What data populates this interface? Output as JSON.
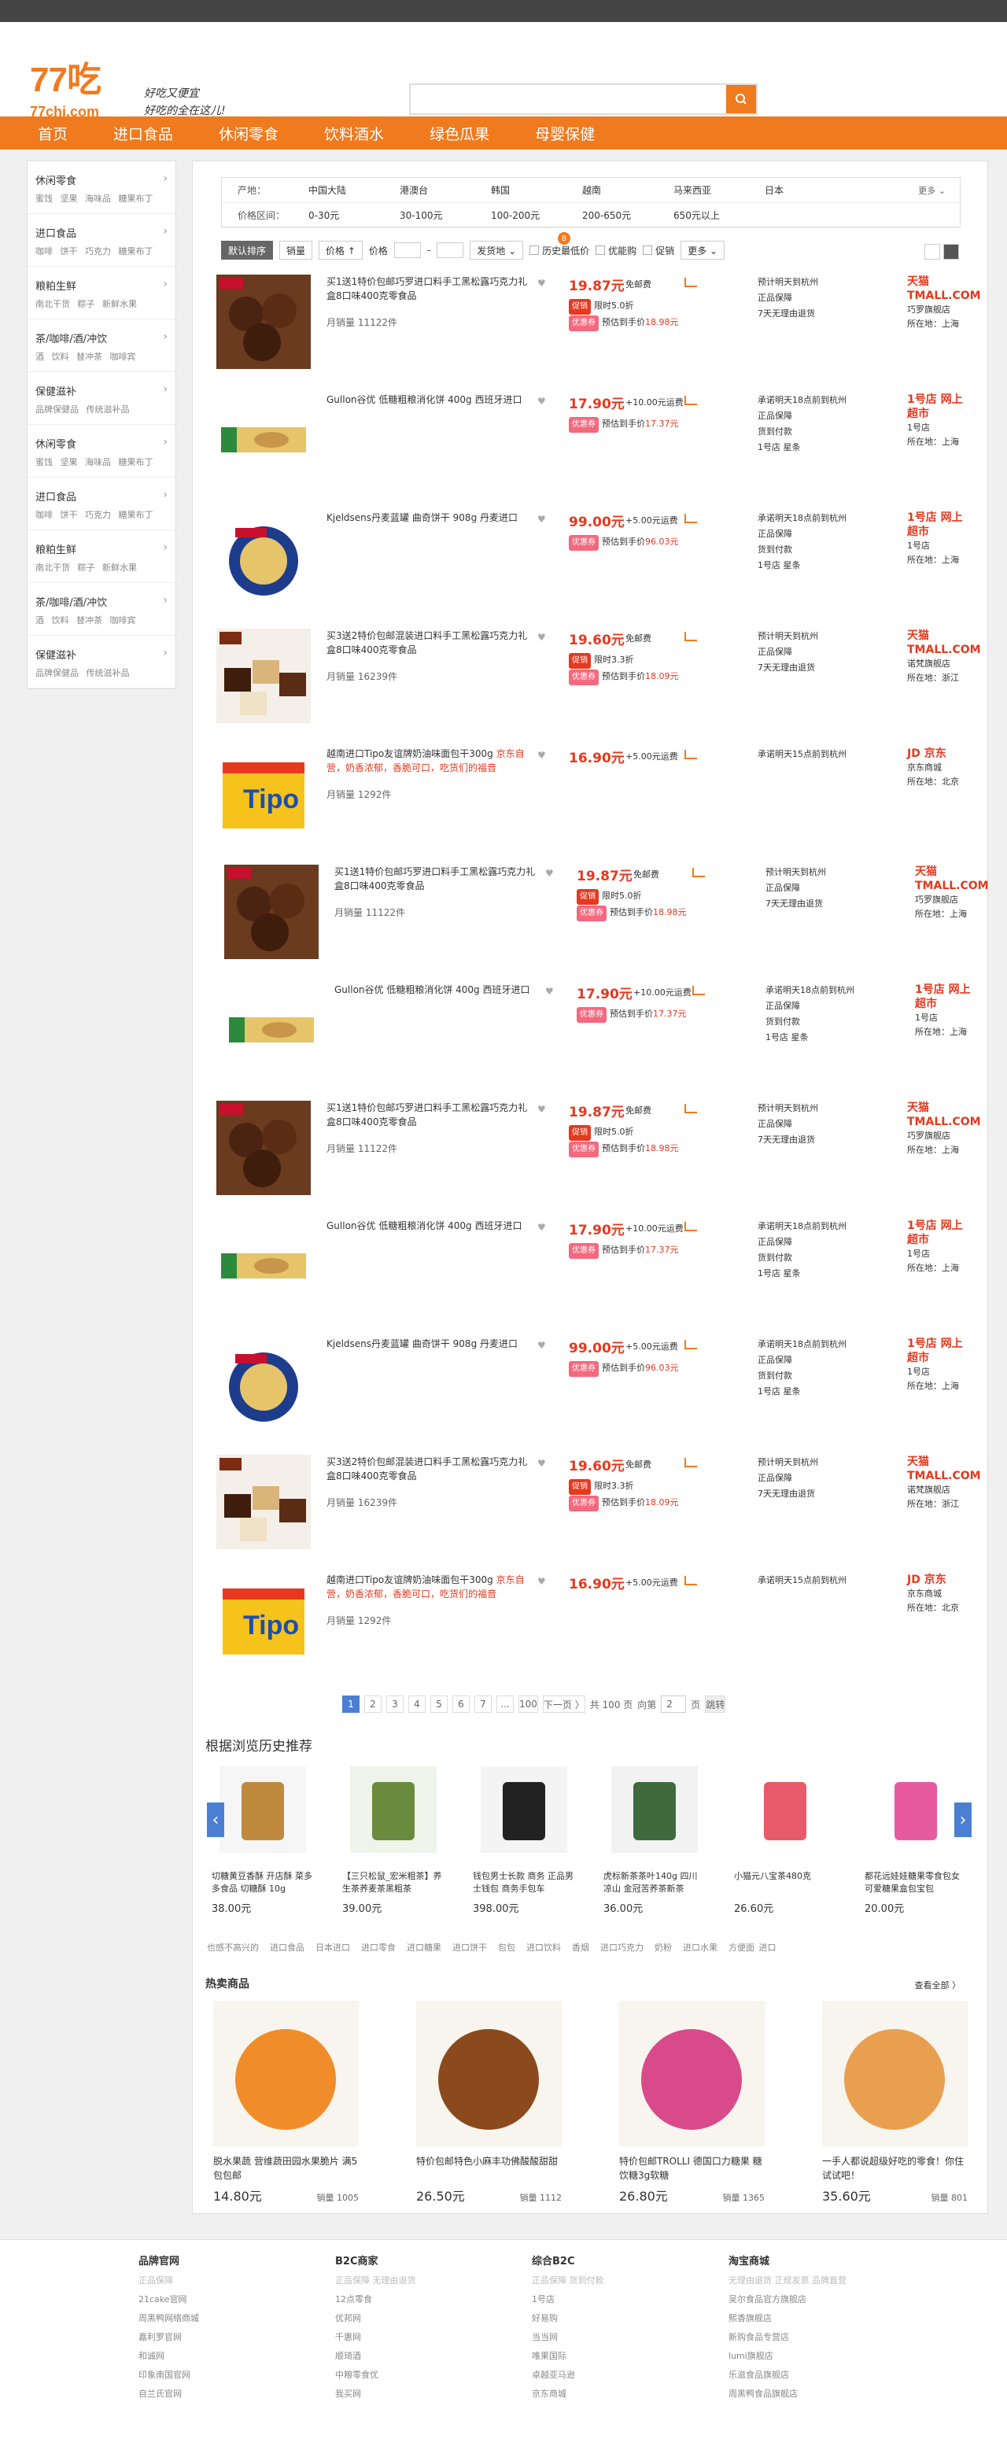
{
  "brand": {
    "logo": "77吃",
    "domain": "77chi.com",
    "slogan_1": "好吃又便宜",
    "slogan_2": "好吃的全在这儿!",
    "accent": "#f07a1e"
  },
  "nav": [
    "首页",
    "进口食品",
    "休闲零食",
    "饮料酒水",
    "绿色瓜果",
    "母婴保健"
  ],
  "sidebar": [
    {
      "title": "休闲零食",
      "sub": "蜜饯 坚果 海味品 糖果布丁"
    },
    {
      "title": "进口食品",
      "sub": "咖啡 饼干 巧克力 糖果布丁"
    },
    {
      "title": "粮粕生鲜",
      "sub": "南北干货 粽子 新鲜水果"
    },
    {
      "title": "茶/咖啡/酒/冲饮",
      "sub": "酒 饮料 替冲茶 咖啡宾"
    },
    {
      "title": "保健滋补",
      "sub": "品牌保健品 传统滋补品"
    },
    {
      "title": "休闲零食",
      "sub": "蜜饯 坚果 海味品 糖果布丁"
    },
    {
      "title": "进口食品",
      "sub": "咖啡 饼干 巧克力 糖果布丁"
    },
    {
      "title": "粮粕生鲜",
      "sub": "南北干货 粽子 新鲜水果"
    },
    {
      "title": "茶/咖啡/酒/冲饮",
      "sub": "酒 饮料 替冲茶 咖啡宾"
    },
    {
      "title": "保健滋补",
      "sub": "品牌保健品 传统滋补品"
    }
  ],
  "filter": {
    "origin_label": "产地：",
    "origins": [
      "中国大陆",
      "港澳台",
      "韩国",
      "越南",
      "马来西亚",
      "日本"
    ],
    "more": "更多 ⌄",
    "price_label": "价格区间：",
    "prices": [
      "0-30元",
      "30-100元",
      "100-200元",
      "200-650元",
      "650元以上"
    ]
  },
  "sort": {
    "default": "默认排序",
    "sales": "销量",
    "price": "价格 ↑",
    "price_range": "价格",
    "ship": "发货地 ⌄",
    "history_low": "历史最低价",
    "discount": "优能购",
    "promo": "促销",
    "more": "更多 ⌄",
    "badge": "8"
  },
  "products": [
    {
      "name": "买1送1特价包邮巧罗进口料手工黑松露巧克力礼盒8口味400克零食品",
      "promo": "",
      "sales": "月销量 11122件",
      "price": "19.87元",
      "ship": "免邮费",
      "tag1": "促销",
      "tag1_text": "限时5.0折",
      "tag2": "优惠券",
      "tag2_text": "预估到手价",
      "final": "18.98元",
      "logi": [
        "预计明天到杭州",
        "正品保障",
        "7天无理由退货"
      ],
      "shop_brand": "天猫 TMALL.COM",
      "shop_name": "巧罗旗舰店",
      "shop_loc": "所在地：上海",
      "img": "choco",
      "brand_color": "#e8381e"
    },
    {
      "name": "Gullon谷优 低糖粗粮消化饼 400g 西班牙进口",
      "promo": "",
      "sales": "",
      "price": "17.90元",
      "ship": "+10.00元运费",
      "tag1": "",
      "tag1_text": "",
      "tag2": "优惠券",
      "tag2_text": "预估到手价",
      "final": "17.37元",
      "logi": [
        "承诺明天18点前到杭州",
        "正品保障",
        "货到付款",
        "1号店 星条"
      ],
      "shop_brand": "1号店 网上超市",
      "shop_name": "1号店",
      "shop_loc": "所在地：上海",
      "img": "biscuit",
      "brand_color": "#e8381e"
    },
    {
      "name": "Kjeldsens丹麦蓝罐 曲奇饼干 908g 丹麦进口",
      "promo": "",
      "sales": "",
      "price": "99.00元",
      "ship": "+5.00元运费",
      "tag1": "",
      "tag1_text": "",
      "tag2": "优惠券",
      "tag2_text": "预估到手价",
      "final": "96.03元",
      "logi": [
        "承诺明天18点前到杭州",
        "正品保障",
        "货到付款",
        "1号店 星条"
      ],
      "shop_brand": "1号店 网上超市",
      "shop_name": "1号店",
      "shop_loc": "所在地：上海",
      "img": "cookie",
      "brand_color": "#e8381e"
    },
    {
      "name": "买3送2特价包邮混装进口料手工黑松露巧克力礼盒8口味400克零食品",
      "promo": "",
      "sales": "月销量 16239件",
      "price": "19.60元",
      "ship": "免邮费",
      "tag1": "促销",
      "tag1_text": "限时3.3折",
      "tag2": "优惠券",
      "tag2_text": "预估到手价",
      "final": "18.09元",
      "logi": [
        "预计明天到杭州",
        "正品保障",
        "7天无理由退货"
      ],
      "shop_brand": "天猫 TMALL.COM",
      "shop_name": "诺梵旗舰店",
      "shop_loc": "所在地：浙江",
      "img": "mix",
      "brand_color": "#e8381e"
    },
    {
      "name": "越南进口Tipo友谊牌奶油味面包干300g ",
      "promo": "京东自营，奶香浓郁，香脆可口，吃货们的福音",
      "sales": "月销量 1292件",
      "price": "16.90元",
      "ship": "+5.00元运费",
      "tag1": "",
      "tag1_text": "",
      "tag2": "",
      "tag2_text": "",
      "final": "",
      "logi": [
        "承诺明天15点前到杭州"
      ],
      "shop_brand": "JD 京东",
      "shop_name": "京东商城",
      "shop_loc": "所在地：北京",
      "img": "tipo",
      "brand_color": "#e8381e"
    },
    {
      "name": "买1送1特价包邮巧罗进口料手工黑松露巧克力礼盒8口味400克零食品",
      "promo": "",
      "sales": "月销量 11122件",
      "price": "19.87元",
      "ship": "免邮费",
      "tag1": "促销",
      "tag1_text": "限时5.0折",
      "tag2": "优惠券",
      "tag2_text": "预估到手价",
      "final": "18.98元",
      "logi": [
        "预计明天到杭州",
        "正品保障",
        "7天无理由退货"
      ],
      "shop_brand": "天猫 TMALL.COM",
      "shop_name": "巧罗旗舰店",
      "shop_loc": "所在地：上海",
      "img": "choco",
      "brand_color": "#e8381e"
    },
    {
      "name": "Gullon谷优 低糖粗粮消化饼 400g 西班牙进口",
      "promo": "",
      "sales": "",
      "price": "17.90元",
      "ship": "+10.00元运费",
      "tag1": "",
      "tag1_text": "",
      "tag2": "优惠券",
      "tag2_text": "预估到手价",
      "final": "17.37元",
      "logi": [
        "承诺明天18点前到杭州",
        "正品保障",
        "货到付款",
        "1号店 星条"
      ],
      "shop_brand": "1号店 网上超市",
      "shop_name": "1号店",
      "shop_loc": "所在地：上海",
      "img": "biscuit",
      "brand_color": "#e8381e"
    },
    {
      "name": "买1送1特价包邮巧罗进口料手工黑松露巧克力礼盒8口味400克零食品",
      "promo": "",
      "sales": "月销量 11122件",
      "price": "19.87元",
      "ship": "免邮费",
      "tag1": "促销",
      "tag1_text": "限时5.0折",
      "tag2": "优惠券",
      "tag2_text": "预估到手价",
      "final": "18.98元",
      "logi": [
        "预计明天到杭州",
        "正品保障",
        "7天无理由退货"
      ],
      "shop_brand": "天猫 TMALL.COM",
      "shop_name": "巧罗旗舰店",
      "shop_loc": "所在地：上海",
      "img": "choco",
      "brand_color": "#e8381e"
    },
    {
      "name": "Gullon谷优 低糖粗粮消化饼 400g 西班牙进口",
      "promo": "",
      "sales": "",
      "price": "17.90元",
      "ship": "+10.00元运费",
      "tag1": "",
      "tag1_text": "",
      "tag2": "优惠券",
      "tag2_text": "预估到手价",
      "final": "17.37元",
      "logi": [
        "承诺明天18点前到杭州",
        "正品保障",
        "货到付款",
        "1号店 星条"
      ],
      "shop_brand": "1号店 网上超市",
      "shop_name": "1号店",
      "shop_loc": "所在地：上海",
      "img": "biscuit",
      "brand_color": "#e8381e"
    },
    {
      "name": "Kjeldsens丹麦蓝罐 曲奇饼干 908g 丹麦进口",
      "promo": "",
      "sales": "",
      "price": "99.00元",
      "ship": "+5.00元运费",
      "tag1": "",
      "tag1_text": "",
      "tag2": "优惠券",
      "tag2_text": "预估到手价",
      "final": "96.03元",
      "logi": [
        "承诺明天18点前到杭州",
        "正品保障",
        "货到付款",
        "1号店 星条"
      ],
      "shop_brand": "1号店 网上超市",
      "shop_name": "1号店",
      "shop_loc": "所在地：上海",
      "img": "cookie",
      "brand_color": "#e8381e"
    },
    {
      "name": "买3送2特价包邮混装进口料手工黑松露巧克力礼盒8口味400克零食品",
      "promo": "",
      "sales": "月销量 16239件",
      "price": "19.60元",
      "ship": "免邮费",
      "tag1": "促销",
      "tag1_text": "限时3.3折",
      "tag2": "优惠券",
      "tag2_text": "预估到手价",
      "final": "18.09元",
      "logi": [
        "预计明天到杭州",
        "正品保障",
        "7天无理由退货"
      ],
      "shop_brand": "天猫 TMALL.COM",
      "shop_name": "诺梵旗舰店",
      "shop_loc": "所在地：浙江",
      "img": "mix",
      "brand_color": "#e8381e"
    },
    {
      "name": "越南进口Tipo友谊牌奶油味面包干300g ",
      "promo": "京东自营，奶香浓郁，香脆可口，吃货们的福音",
      "sales": "月销量 1292件",
      "price": "16.90元",
      "ship": "+5.00元运费",
      "tag1": "",
      "tag1_text": "",
      "tag2": "",
      "tag2_text": "",
      "final": "",
      "logi": [
        "承诺明天15点前到杭州"
      ],
      "shop_brand": "JD 京东",
      "shop_name": "京东商城",
      "shop_loc": "所在地：北京",
      "img": "tipo",
      "brand_color": "#e8381e"
    }
  ],
  "pager": {
    "pages": [
      "1",
      "2",
      "3",
      "4",
      "5",
      "6",
      "7",
      "...",
      "100"
    ],
    "next": "下一页 〉",
    "total": "共 100 页",
    "goto_label": "向第",
    "goto_value": "2",
    "page_unit": "页",
    "go": "跳转"
  },
  "history": {
    "title": "根据浏览历史推荐",
    "items": [
      {
        "title": "切糖黄豆香酥 开店酥 菜多多食品 切糖酥 10g",
        "price": "38.00元"
      },
      {
        "title": "【三只松鼠_宏米粗茶】养生茶荞麦茶黑粗茶",
        "price": "39.00元"
      },
      {
        "title": "钱包男士长款 商务 正品男士钱包 商务手包车",
        "price": "398.00元"
      },
      {
        "title": "虎标新茶茶叶140g 四川凉山 金冠苦荞茶新茶",
        "price": "36.00元"
      },
      {
        "title": "小猫元八宝茶480克",
        "price": "26.60元"
      },
      {
        "title": "都花远娃娃糖果零食包女 可爱糖果盒包宝包",
        "price": "20.00元"
      }
    ],
    "keywords": [
      "也感不高兴的",
      "进口食品",
      "日本进口",
      "进口零食",
      "进口糖果",
      "进口饼干",
      "包包",
      "进口饮料",
      "香烟",
      "进口巧克力",
      "奶粉",
      "进口水果",
      "方便面 进口"
    ]
  },
  "hot": {
    "title": "热卖商品",
    "more": "查看全部 〉",
    "items": [
      {
        "title": "脱水果蔬 营维蔬田园水果脆片 满5包包邮",
        "price": "14.80元",
        "sales": "销量 1005"
      },
      {
        "title": "特价包邮特色小麻丰功佛酸酸甜甜",
        "price": "26.50元",
        "sales": "销量 1112"
      },
      {
        "title": "特价包邮TROLLI 德国口力糖果 糖饮糖3g软糖",
        "price": "26.80元",
        "sales": "销量 1365"
      },
      {
        "title": "一手人都说超级好吃的零食！你住试试吧！",
        "price": "35.60元",
        "sales": "销量 801"
      }
    ]
  },
  "footer": [
    {
      "title": "品牌官网",
      "sub": "正品保障",
      "links": [
        "21cake官网",
        "周黑鸭网络商城",
        "嘉利罗官网",
        "和诚网",
        "印象南国官网",
        "自兰氏官网"
      ]
    },
    {
      "title": "B2C商家",
      "sub": "正品保障 无理由退货",
      "links": [
        "12点零食",
        "优邦网",
        "千惠网",
        "顺琦酒",
        "中粮零食优",
        "我买网"
      ]
    },
    {
      "title": "综合B2C",
      "sub": "正品保障 货到付款",
      "links": [
        "1号店",
        "好易购",
        "当当网",
        "唯果国际",
        "卓越亚马逊",
        "京东商城"
      ]
    },
    {
      "title": "淘宝商城",
      "sub": "无理由退货 正规发票 品牌直营",
      "links": [
        "吴尔食品官方旗舰店",
        "熙香旗舰店",
        "新购食品专营店",
        "lumi旗舰店",
        "乐滋食品旗舰店",
        "周黑鸭食品旗舰店"
      ]
    }
  ]
}
